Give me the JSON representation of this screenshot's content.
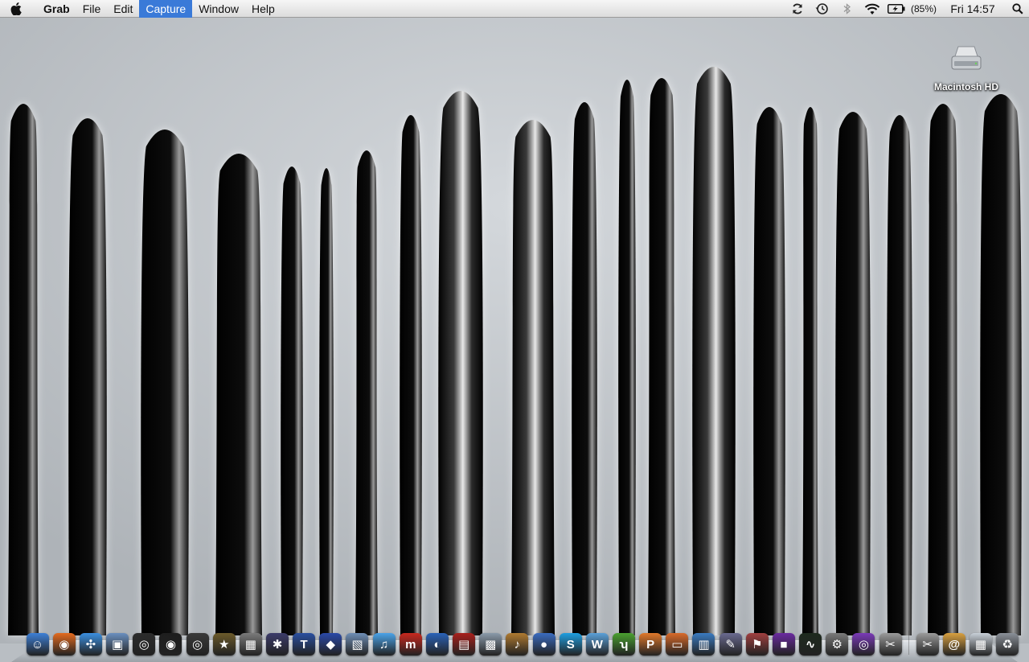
{
  "menubar": {
    "apple_icon": "apple-logo-icon",
    "app_name": "Grab",
    "menus": [
      "File",
      "Edit",
      "Capture",
      "Window",
      "Help"
    ],
    "active_menu": "Capture",
    "status": {
      "sync_icon": "sync-icon",
      "time_machine_icon": "time-machine-icon",
      "bluetooth_icon": "bluetooth-icon",
      "wifi_icon": "wifi-icon",
      "battery_icon": "battery-charging-icon",
      "battery_percent": "(85%)",
      "clock": "Fri 14:57",
      "spotlight_icon": "spotlight-search-icon"
    }
  },
  "desktop": {
    "drive_label": "Macintosh HD"
  },
  "dock": {
    "apps": [
      {
        "name": "finder-icon",
        "color": "#3d7fd6",
        "glyph": "☺"
      },
      {
        "name": "firefox-icon",
        "color": "#e36a1e",
        "glyph": "◉"
      },
      {
        "name": "safari-icon",
        "color": "#3b8fe0",
        "glyph": "✣"
      },
      {
        "name": "preview-icon",
        "color": "#6a8fbf",
        "glyph": "▣"
      },
      {
        "name": "camera-icon",
        "color": "#2c2c2c",
        "glyph": "◎"
      },
      {
        "name": "lens-icon",
        "color": "#1e1e1e",
        "glyph": "◉"
      },
      {
        "name": "photo-booth-icon",
        "color": "#3a3a3a",
        "glyph": "◎"
      },
      {
        "name": "star-icon",
        "color": "#6b5a2a",
        "glyph": "★"
      },
      {
        "name": "image-capture-icon",
        "color": "#7a7a7a",
        "glyph": "▦"
      },
      {
        "name": "imovie-icon",
        "color": "#3c3c6a",
        "glyph": "✱"
      },
      {
        "name": "text-app-icon",
        "color": "#2a4fa0",
        "glyph": "T"
      },
      {
        "name": "blue-cube-icon",
        "color": "#2a49a8",
        "glyph": "◆"
      },
      {
        "name": "iphoto-icon",
        "color": "#6e8db5",
        "glyph": "▧"
      },
      {
        "name": "itunes-icon",
        "color": "#4aa3e8",
        "glyph": "♫"
      },
      {
        "name": "miro-icon",
        "color": "#c8281e",
        "glyph": "m"
      },
      {
        "name": "google-earth-icon",
        "color": "#2a62b8",
        "glyph": "◐"
      },
      {
        "name": "photo-album-icon",
        "color": "#a8201c",
        "glyph": "▤"
      },
      {
        "name": "slideshow-icon",
        "color": "#8a9aaa",
        "glyph": "▩"
      },
      {
        "name": "garageband-icon",
        "color": "#b07a30",
        "glyph": "♪"
      },
      {
        "name": "adium-icon",
        "color": "#3a6bbf",
        "glyph": "●"
      },
      {
        "name": "skype-icon",
        "color": "#1e9ee0",
        "glyph": "S"
      },
      {
        "name": "word-icon",
        "color": "#5aa0d8",
        "glyph": "W"
      },
      {
        "name": "green-app-icon",
        "color": "#4aa030",
        "glyph": "ʮ"
      },
      {
        "name": "powerpoint-icon",
        "color": "#e0782a",
        "glyph": "P"
      },
      {
        "name": "presentation-icon",
        "color": "#d86a2a",
        "glyph": "▭"
      },
      {
        "name": "charts-icon",
        "color": "#3a7ac0",
        "glyph": "▥"
      },
      {
        "name": "script-editor-icon",
        "color": "#6a6a90",
        "glyph": "✎"
      },
      {
        "name": "utility-icon",
        "color": "#a04040",
        "glyph": "⚑"
      },
      {
        "name": "purple-app-icon",
        "color": "#6a2aa0",
        "glyph": "■"
      },
      {
        "name": "activity-monitor-icon",
        "color": "#1e2a1e",
        "glyph": "∿"
      },
      {
        "name": "system-preferences-icon",
        "color": "#7a7a7a",
        "glyph": "⚙"
      },
      {
        "name": "hypnotic-icon",
        "color": "#7a3ab8",
        "glyph": "◎"
      },
      {
        "name": "grab-icon",
        "color": "#9a9a9a",
        "glyph": "✂"
      }
    ],
    "stacks": [
      {
        "name": "documents-stack-icon",
        "color": "#9a9a9a",
        "glyph": "✂"
      },
      {
        "name": "mail-stack-icon",
        "color": "#d8a040",
        "glyph": "@"
      },
      {
        "name": "downloads-stack-icon",
        "color": "#c8d0d8",
        "glyph": "▦"
      },
      {
        "name": "trash-icon",
        "color": "#8a9098",
        "glyph": "♻"
      }
    ]
  }
}
